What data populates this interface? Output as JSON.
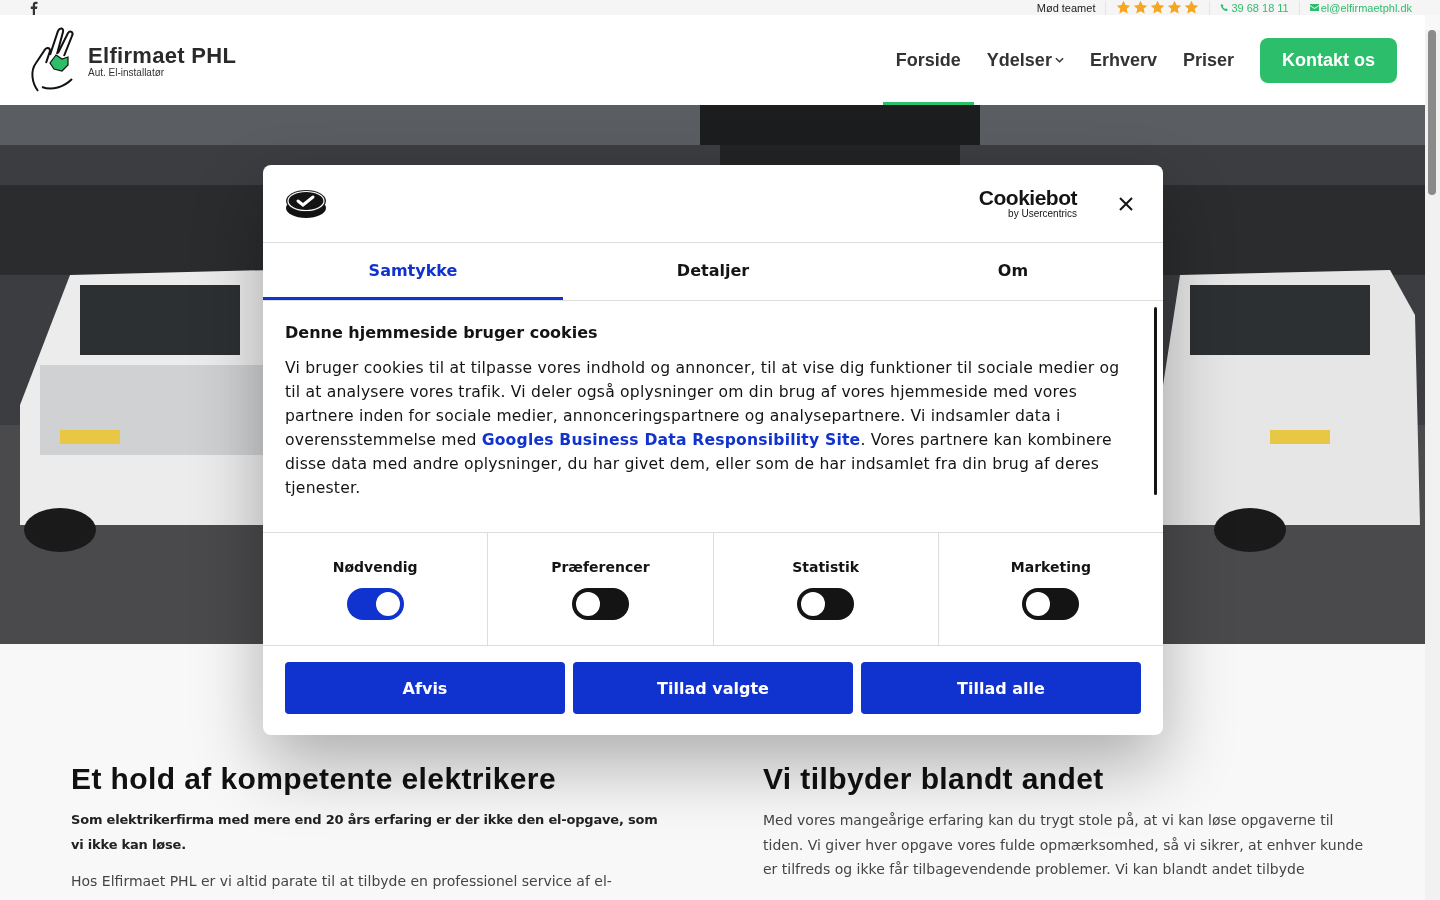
{
  "top_bar": {
    "team_link": "Mød teamet",
    "rating": {
      "stars": 5
    },
    "phone": "39 68 18 11",
    "email": "el@elfirmaetphl.dk"
  },
  "header": {
    "logo_name": "Elfirmaet PHL",
    "logo_tagline": "Aut. El-installatør",
    "nav": [
      {
        "label": "Forside",
        "selected": true,
        "kind": "link"
      },
      {
        "label": "Ydelser",
        "selected": false,
        "kind": "dropdown"
      },
      {
        "label": "Erhverv",
        "selected": false,
        "kind": "link"
      },
      {
        "label": "Priser",
        "selected": false,
        "kind": "link"
      }
    ],
    "cta": "Kontakt os"
  },
  "cookie_dialog": {
    "brand": "Cookiebot",
    "brand_sub": "by Usercentrics",
    "tabs": [
      {
        "label": "Samtykke",
        "selected": true
      },
      {
        "label": "Detaljer",
        "selected": false
      },
      {
        "label": "Om",
        "selected": false
      }
    ],
    "heading": "Denne hjemmeside bruger cookies",
    "body_before": "Vi bruger cookies til at tilpasse vores indhold og annoncer, til at vise dig funktioner til sociale medier og til at analysere vores trafik. Vi deler også oplysninger om din brug af vores hjemmeside med vores partnere inden for sociale medier, annonceringspartnere og analysepartnere. Vi indsamler data i overensstemmelse med",
    "body_link": "Googles Business Data Responsibility Site",
    "body_after": ". Vores partnere kan kombinere disse data med andre oplysninger, du har givet dem, eller som de har indsamlet fra din brug af deres tjenester.",
    "toggles": [
      {
        "label": "Nødvendig",
        "on": true
      },
      {
        "label": "Præferencer",
        "on": false
      },
      {
        "label": "Statistik",
        "on": false
      },
      {
        "label": "Marketing",
        "on": false
      }
    ],
    "buttons": [
      "Afvis",
      "Tillad valgte",
      "Tillad alle"
    ]
  },
  "content": [
    {
      "heading": "Et hold af kompetente elektrikere",
      "paragraphs": [
        {
          "text": "Som elektrikerfirma med mere end 20 års erfaring er der ikke den el-opgave, som vi ikke kan løse.",
          "bold": true
        },
        {
          "text": "Hos Elfirmaet PHL er vi altid parate til at tilbyde en professionel service af el-",
          "bold": false
        }
      ]
    },
    {
      "heading": "Vi tilbyder blandt andet",
      "paragraphs": [
        {
          "text": "Med vores mangeårige erfaring kan du trygt stole på, at vi kan løse opgaverne til tiden. Vi giver hver opgave vores fulde opmærksomhed, så vi sikrer, at enhver kunde er tilfreds og ikke får tilbagevendende problemer. Vi kan blandt andet tilbyde",
          "bold": false
        }
      ]
    }
  ]
}
